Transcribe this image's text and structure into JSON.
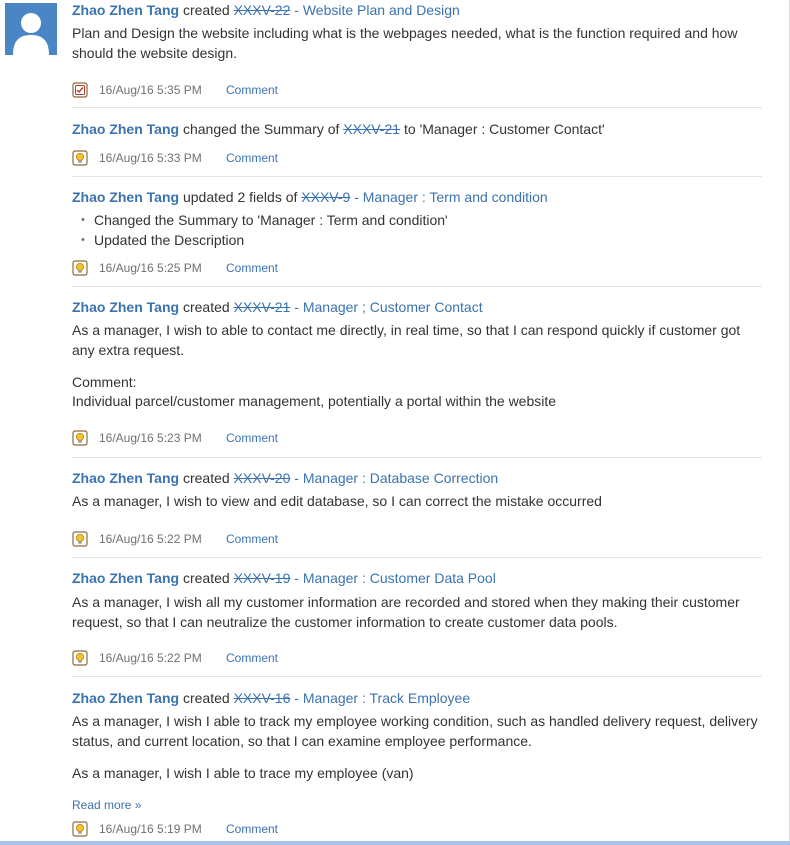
{
  "author": "Zhao Zhen Tang",
  "comment_label": "Comment",
  "read_more": "Read more »",
  "entries": [
    {
      "verb": "created",
      "key": "XXXV-22",
      "title": "- Website Plan and Design",
      "body": "Plan and Design the website including what is the webpages needed, what is the function required and how should the website design.",
      "time": "16/Aug/16 5:35 PM",
      "icon": "task-icon"
    },
    {
      "verb": "changed the Summary of",
      "key": "XXXV-21",
      "suffix": "to 'Manager : Customer Contact'",
      "time": "16/Aug/16 5:33 PM",
      "icon": "story-icon"
    },
    {
      "verb": "updated 2 fields of",
      "key": "XXXV-9",
      "title": "- Manager : Term and condition",
      "bullets": [
        "Changed the Summary to 'Manager : Term and condition'",
        "Updated the Description"
      ],
      "time": "16/Aug/16 5:25 PM",
      "icon": "story-icon"
    },
    {
      "verb": "created",
      "key": "XXXV-21",
      "title": "- Manager ; Customer Contact",
      "body": "As a manager, I wish to able to contact me directly, in real time, so that I can respond quickly if customer got any extra request.",
      "comment_heading": "Comment:",
      "comment_text": "Individual parcel/customer management, potentially a portal within the website",
      "time": "16/Aug/16 5:23 PM",
      "icon": "story-icon"
    },
    {
      "verb": "created",
      "key": "XXXV-20",
      "title": "- Manager : Database Correction",
      "body": "As a manager, I wish to view and edit database, so I can correct the mistake occurred",
      "time": "16/Aug/16 5:22 PM",
      "icon": "story-icon"
    },
    {
      "verb": "created",
      "key": "XXXV-19",
      "title": "- Manager : Customer Data Pool",
      "body": "As a manager, I wish all my customer information are recorded and stored when they making their customer request, so that I can neutralize the customer information to create customer data pools.",
      "time": "16/Aug/16 5:22 PM",
      "icon": "story-icon"
    },
    {
      "verb": "created",
      "key": "XXXV-16",
      "title": "- Manager : Track Employee",
      "body": "As a manager, I wish I able to track my employee working condition, such as handled delivery request, delivery status, and current location, so that I can examine employee performance.",
      "body2": "As a manager, I wish I able to trace my employee (van)",
      "time": "16/Aug/16 5:19 PM",
      "icon": "story-icon"
    }
  ]
}
